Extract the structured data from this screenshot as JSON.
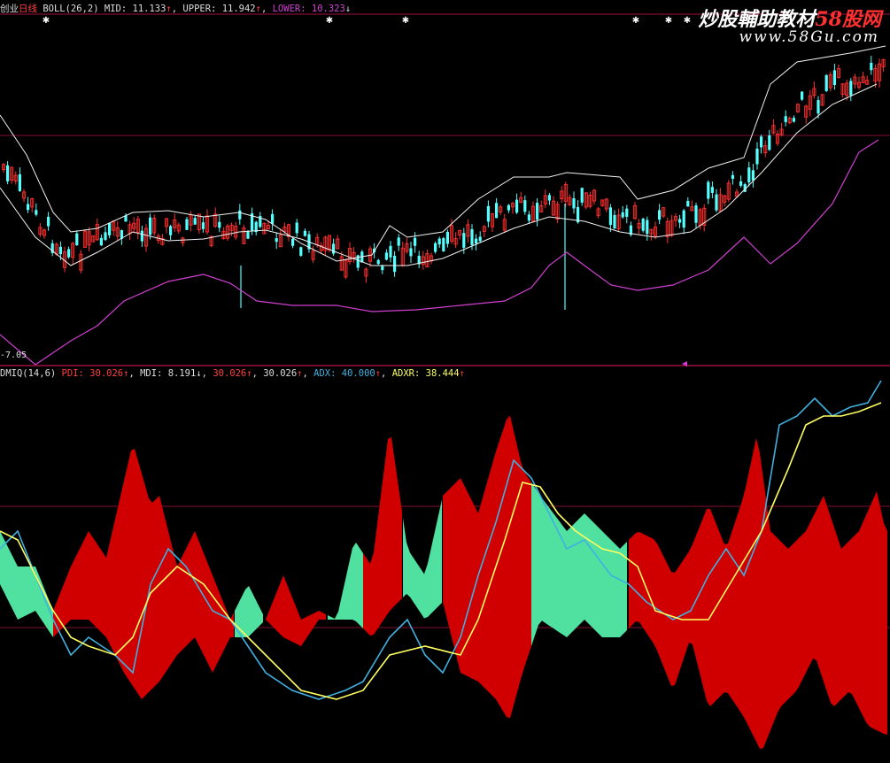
{
  "boll_header": {
    "name": "创业",
    "period": "日线",
    "indicator": "BOLL(26,2)",
    "mid_label": "MID:",
    "mid_value": "11.133",
    "mid_arrow": "↑",
    "upper_label": "UPPER:",
    "upper_value": "11.942",
    "upper_arrow": "↑",
    "lower_label": "LOWER:",
    "lower_value": "10.323",
    "lower_arrow": "↓"
  },
  "dmi_header": {
    "indicator": "DMIQ(14,6)",
    "pdi_label": "PDI:",
    "pdi_value": "30.026",
    "pdi_arrow": "↑",
    "mdi_label": "MDI:",
    "mdi_value": "8.191",
    "mdi_arrow": "↓",
    "v3_value": "30.026",
    "v3_arrow": "↑",
    "v4_value": "30.026",
    "v4_arrow": "↑",
    "adx_label": "ADX:",
    "adx_value": "40.000",
    "adx_arrow": "↑",
    "adxr_label": "ADXR:",
    "adxr_value": "38.444",
    "adxr_arrow": "↑"
  },
  "lower_price_label": "-7.05",
  "watermark": {
    "title_a": "炒股輔助教材",
    "title_b": "58股网",
    "url": "www.58Gu.com"
  },
  "colors": {
    "background": "#000000",
    "up_candle": "#ff3030",
    "down_candle": "#54ffff",
    "boll_mid": "#f0f0f0",
    "boll_upper": "#f0f0f0",
    "boll_lower": "#d040d0",
    "pdi_fill": "#d00000",
    "mdi_fill": "#50e0a0",
    "adx_line": "#40b0e0",
    "adxr_line": "#ffff60",
    "separator": "#a01040",
    "grid": "#801030"
  }
}
